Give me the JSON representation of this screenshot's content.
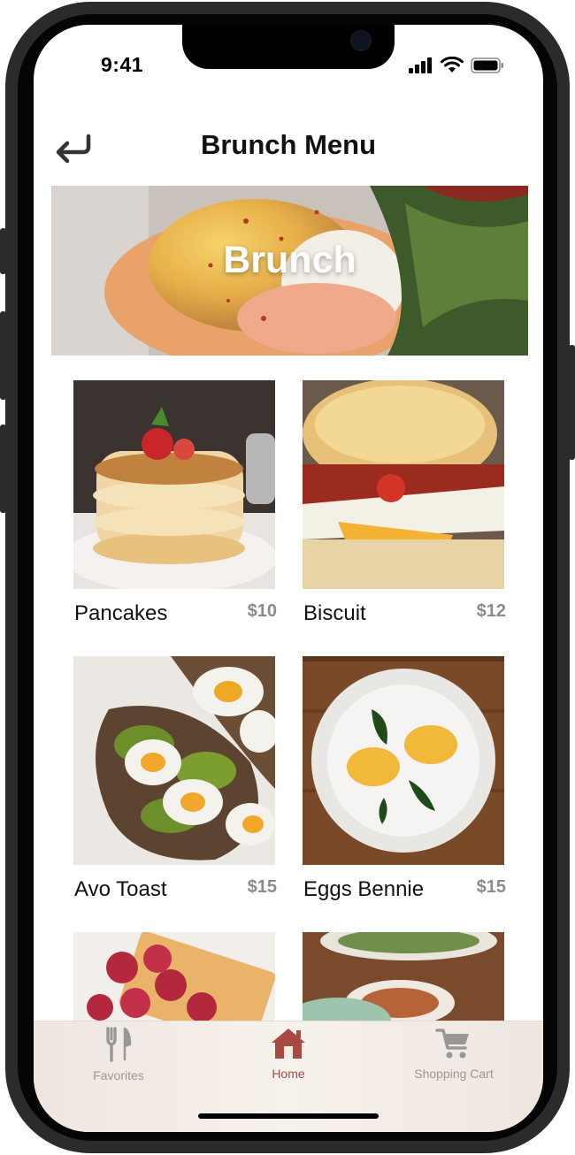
{
  "status_bar": {
    "time": "9:41"
  },
  "header": {
    "title": "Brunch Menu"
  },
  "hero": {
    "label": "Brunch"
  },
  "menu": {
    "items": [
      {
        "name": "Pancakes",
        "price": "$10"
      },
      {
        "name": "Biscuit",
        "price": "$12"
      },
      {
        "name": "Avo Toast",
        "price": "$15"
      },
      {
        "name": "Eggs Bennie",
        "price": "$15"
      }
    ]
  },
  "tabbar": {
    "items": [
      {
        "label": "Favorites",
        "icon": "fork-knife-icon"
      },
      {
        "label": "Home",
        "icon": "home-icon",
        "active": true
      },
      {
        "label": "Shopping Cart",
        "icon": "cart-icon"
      }
    ]
  },
  "colors": {
    "accent": "#a94a42",
    "inactive": "#9a9896"
  }
}
